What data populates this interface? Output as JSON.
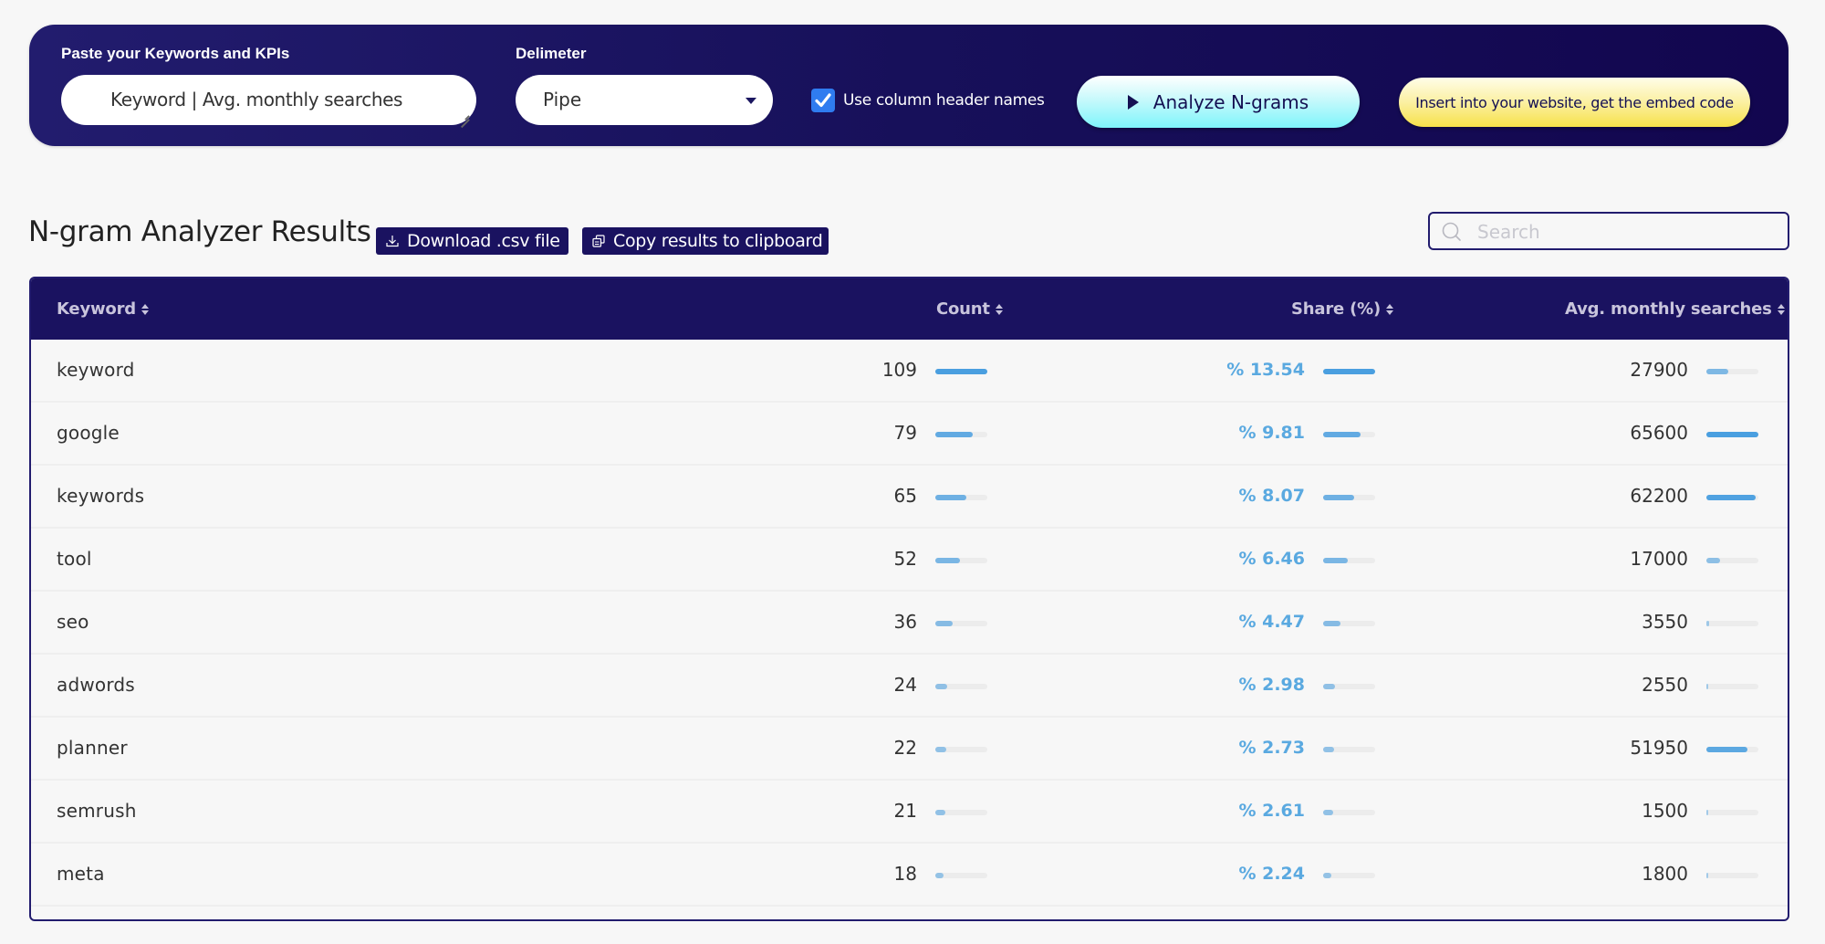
{
  "input_panel": {
    "keywords_label": "Paste your Keywords and KPIs",
    "keywords_value": "Keyword | Avg. monthly searches",
    "delimiter_label": "Delimeter",
    "delimiter_value": "Pipe",
    "use_header_checkbox_label": "Use column header names",
    "use_header_checked": true,
    "analyze_button": "Analyze N-grams",
    "embed_button": "Insert into your website, get the embed code"
  },
  "results": {
    "title": "N-gram Analyzer Results",
    "download_button": "Download .csv file",
    "copy_button": "Copy results to clipboard",
    "search_placeholder": "Search",
    "columns": [
      "Keyword",
      "Count",
      "Share (%)",
      "Avg. monthly searches"
    ],
    "bar_color": "#4a9fe0",
    "rows": [
      {
        "keyword": "keyword",
        "count": "109",
        "share": "% 13.54",
        "searches": "27900",
        "count_frac": 1.0,
        "share_frac": 1.0,
        "searches_frac": 0.425
      },
      {
        "keyword": "google",
        "count": "79",
        "share": "% 9.81",
        "searches": "65600",
        "count_frac": 0.725,
        "share_frac": 0.725,
        "searches_frac": 1.0
      },
      {
        "keyword": "keywords",
        "count": "65",
        "share": "% 8.07",
        "searches": "62200",
        "count_frac": 0.596,
        "share_frac": 0.596,
        "searches_frac": 0.948
      },
      {
        "keyword": "tool",
        "count": "52",
        "share": "% 6.46",
        "searches": "17000",
        "count_frac": 0.477,
        "share_frac": 0.477,
        "searches_frac": 0.259
      },
      {
        "keyword": "seo",
        "count": "36",
        "share": "% 4.47",
        "searches": "3550",
        "count_frac": 0.33,
        "share_frac": 0.33,
        "searches_frac": 0.054
      },
      {
        "keyword": "adwords",
        "count": "24",
        "share": "% 2.98",
        "searches": "2550",
        "count_frac": 0.22,
        "share_frac": 0.22,
        "searches_frac": 0.039
      },
      {
        "keyword": "planner",
        "count": "22",
        "share": "% 2.73",
        "searches": "51950",
        "count_frac": 0.202,
        "share_frac": 0.202,
        "searches_frac": 0.792
      },
      {
        "keyword": "semrush",
        "count": "21",
        "share": "% 2.61",
        "searches": "1500",
        "count_frac": 0.193,
        "share_frac": 0.193,
        "searches_frac": 0.023
      },
      {
        "keyword": "meta",
        "count": "18",
        "share": "% 2.24",
        "searches": "1800",
        "count_frac": 0.165,
        "share_frac": 0.165,
        "searches_frac": 0.027
      }
    ]
  }
}
